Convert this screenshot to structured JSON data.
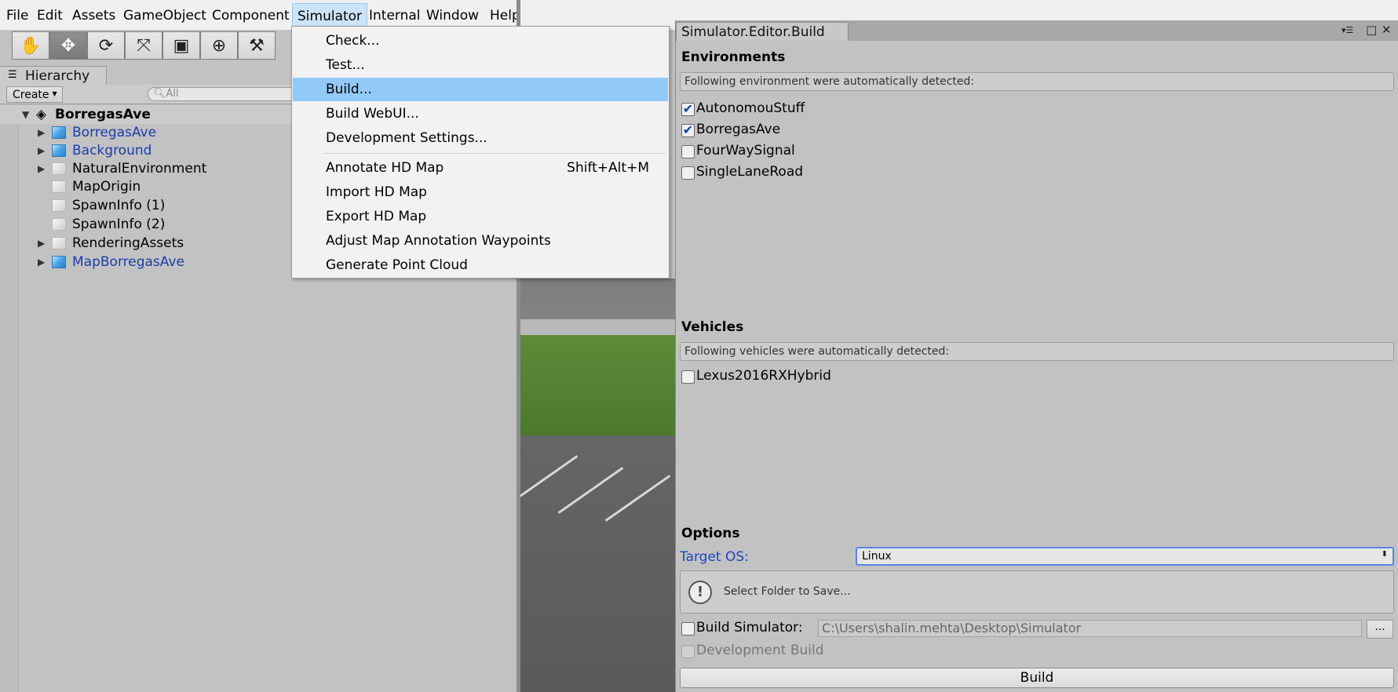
{
  "menubar": {
    "items": [
      "File",
      "Edit",
      "Assets",
      "GameObject",
      "Component",
      "Simulator",
      "Internal",
      "Window",
      "Help"
    ],
    "active": "Simulator"
  },
  "toolbar": {
    "tools": [
      "hand-tool-icon",
      "move-tool-icon",
      "rotate-tool-icon",
      "scale-tool-icon",
      "rect-tool-icon",
      "transform-tool-icon",
      "custom-tool-icon"
    ],
    "active_tool": "move-tool-icon"
  },
  "hierarchy": {
    "tab_label": "Hierarchy",
    "create_label": "Create",
    "search_placeholder": "All",
    "scene_name": "BorregasAve",
    "items": [
      {
        "label": "BorregasAve",
        "expandable": true,
        "prefab": true
      },
      {
        "label": "Background",
        "expandable": true,
        "prefab": true
      },
      {
        "label": "NaturalEnvironment",
        "expandable": true,
        "prefab": false
      },
      {
        "label": "MapOrigin",
        "expandable": false,
        "prefab": false
      },
      {
        "label": "SpawnInfo (1)",
        "expandable": false,
        "prefab": false
      },
      {
        "label": "SpawnInfo (2)",
        "expandable": false,
        "prefab": false
      },
      {
        "label": "RenderingAssets",
        "expandable": true,
        "prefab": false
      },
      {
        "label": "MapBorregasAve",
        "expandable": true,
        "prefab": true
      }
    ]
  },
  "simulator_menu": {
    "items": [
      {
        "label": "Check...",
        "shortcut": ""
      },
      {
        "label": "Test...",
        "shortcut": ""
      },
      {
        "label": "Build...",
        "shortcut": "",
        "highlighted": true
      },
      {
        "label": "Build WebUI...",
        "shortcut": ""
      },
      {
        "label": "Development Settings...",
        "shortcut": ""
      },
      {
        "label": "Annotate HD Map",
        "shortcut": "Shift+Alt+M"
      },
      {
        "label": "Import HD Map",
        "shortcut": ""
      },
      {
        "label": "Export HD Map",
        "shortcut": ""
      },
      {
        "label": "Adjust Map Annotation Waypoints",
        "shortcut": ""
      },
      {
        "label": "Generate Point Cloud",
        "shortcut": ""
      }
    ]
  },
  "build_window": {
    "tab_title": "Simulator.Editor.Build",
    "environments": {
      "heading": "Environments",
      "help": "Following environment were automatically detected:",
      "items": [
        {
          "label": "AutonomouStuff",
          "checked": true
        },
        {
          "label": "BorregasAve",
          "checked": true
        },
        {
          "label": "FourWaySignal",
          "checked": false
        },
        {
          "label": "SingleLaneRoad",
          "checked": false
        }
      ]
    },
    "vehicles": {
      "heading": "Vehicles",
      "help": "Following vehicles were automatically detected:",
      "items": [
        {
          "label": "Lexus2016RXHybrid",
          "checked": false
        }
      ]
    },
    "options": {
      "heading": "Options",
      "target_os_label": "Target OS:",
      "target_os_value": "Linux",
      "folder_message": "Select Folder to Save...",
      "build_simulator_label": "Build Simulator:",
      "build_simulator_checked": false,
      "path": "C:\\Users\\shalin.mehta\\Desktop\\Simulator",
      "browse_label": "...",
      "development_build_label": "Development Build",
      "development_build_checked": false
    },
    "build_button": "Build"
  },
  "colors": {
    "menu_highlight": "#91c9f7",
    "prefab_text": "#1a3da6",
    "target_os_label": "#1d46c4"
  }
}
